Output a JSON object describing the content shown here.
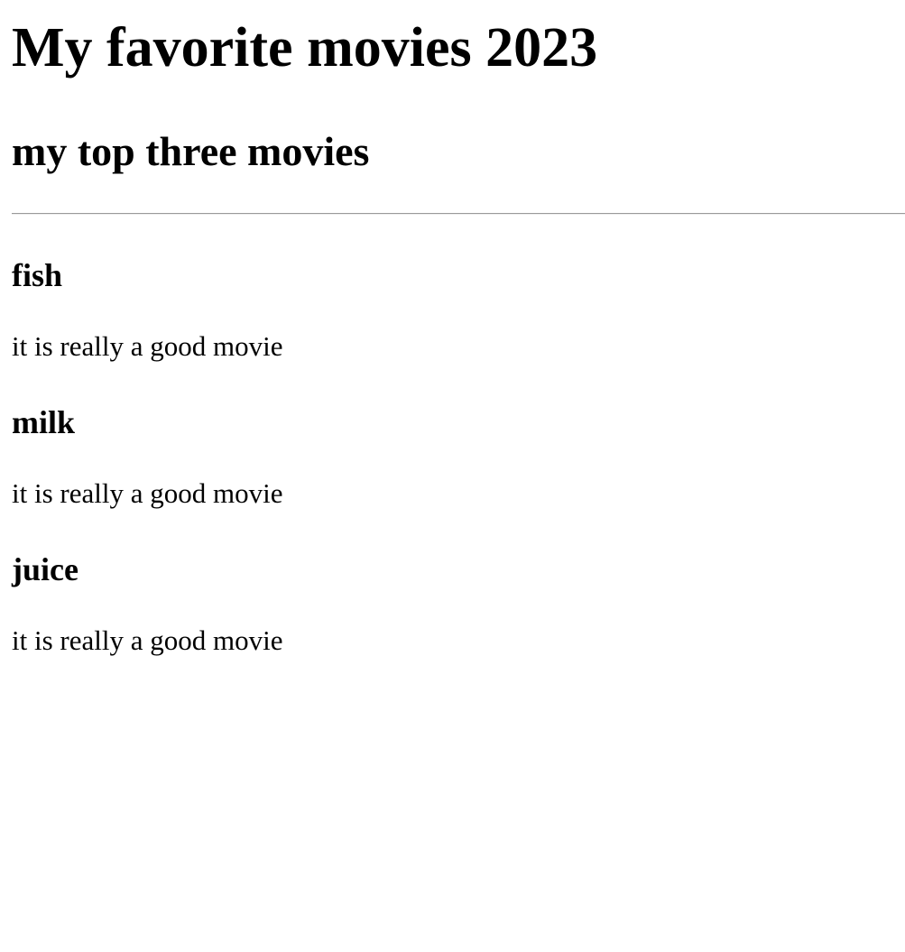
{
  "page": {
    "title": "My favorite movies 2023",
    "subtitle": "my top three movies"
  },
  "movies": [
    {
      "name": "fish",
      "description": "it is really a good movie"
    },
    {
      "name": "milk",
      "description": "it is really a good movie"
    },
    {
      "name": "juice",
      "description": "it is really a good movie"
    }
  ]
}
